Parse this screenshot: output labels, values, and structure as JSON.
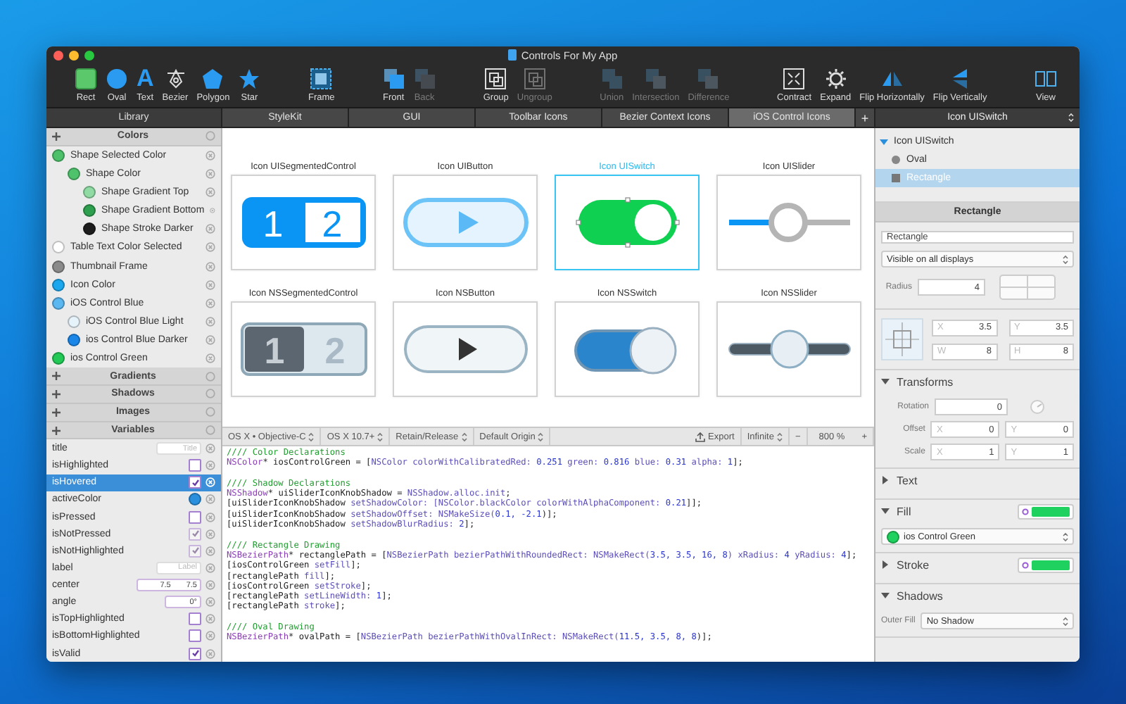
{
  "window": {
    "title": "Controls For My App"
  },
  "toolbar": {
    "groups": [
      [
        {
          "label": "Rect",
          "kind": "rect",
          "disabled": false
        },
        {
          "label": "Oval",
          "kind": "oval",
          "disabled": false
        },
        {
          "label": "Text",
          "kind": "text",
          "glyph": "A",
          "disabled": false
        },
        {
          "label": "Bezier",
          "kind": "bezier",
          "disabled": false
        },
        {
          "label": "Polygon",
          "kind": "polygon",
          "disabled": false
        },
        {
          "label": "Star",
          "kind": "star",
          "disabled": false
        }
      ],
      [
        {
          "label": "Frame",
          "kind": "frame",
          "disabled": false
        }
      ],
      [
        {
          "label": "Front",
          "kind": "front",
          "disabled": false
        },
        {
          "label": "Back",
          "kind": "back",
          "disabled": true
        }
      ],
      [
        {
          "label": "Group",
          "kind": "group",
          "disabled": false
        },
        {
          "label": "Ungroup",
          "kind": "ungroup",
          "disabled": true
        }
      ],
      [
        {
          "label": "Union",
          "kind": "union",
          "disabled": true
        },
        {
          "label": "Intersection",
          "kind": "intersection",
          "disabled": true
        },
        {
          "label": "Difference",
          "kind": "difference",
          "disabled": true
        }
      ],
      [
        {
          "label": "Contract",
          "kind": "contract",
          "disabled": false
        },
        {
          "label": "Expand",
          "kind": "expand",
          "disabled": false
        },
        {
          "label": "Flip Horizontally",
          "kind": "fliph",
          "disabled": false
        },
        {
          "label": "Flip Vertically",
          "kind": "flipv",
          "disabled": false
        }
      ],
      [
        {
          "label": "View",
          "kind": "view",
          "disabled": false
        }
      ]
    ]
  },
  "library": {
    "title": "Library",
    "sections": [
      {
        "title": "Colors",
        "kind": "colors",
        "items": [
          {
            "name": "Shape Selected Color",
            "color": "#4cc16a",
            "children": [
              {
                "name": "Shape Color",
                "color": "#4fc26c",
                "children": [
                  {
                    "name": "Shape Gradient Top",
                    "color": "#8fdba3"
                  },
                  {
                    "name": "Shape Gradient Bottom",
                    "color": "#2e9f4e"
                  },
                  {
                    "name": "Shape Stroke Darker",
                    "color": "#1d1d1d"
                  }
                ]
              }
            ]
          },
          {
            "name": "Table Text Color Selected",
            "color": "#ffffff"
          },
          {
            "name": "Thumbnail Frame",
            "color": "#8a8a8a"
          },
          {
            "name": "Icon Color",
            "color": "#1aa7ee"
          },
          {
            "name": "iOS Control Blue",
            "color": "#5ab7f0",
            "children": [
              {
                "name": "iOS Control Blue Light",
                "color": "#e6f3fb"
              },
              {
                "name": "ios Control Blue Darker",
                "color": "#1a86e8"
              }
            ]
          },
          {
            "name": "ios Control Green",
            "color": "#22c955"
          }
        ]
      },
      {
        "title": "Gradients",
        "kind": "empty"
      },
      {
        "title": "Shadows",
        "kind": "empty"
      },
      {
        "title": "Images",
        "kind": "empty"
      },
      {
        "title": "Variables",
        "kind": "variables",
        "items": [
          {
            "name": "title",
            "kind": "text",
            "placeholder": "Title",
            "selected": false
          },
          {
            "name": "isHighlighted",
            "kind": "bool",
            "checked": false,
            "disabled": false,
            "selected": false
          },
          {
            "name": "isHovered",
            "kind": "bool",
            "checked": true,
            "disabled": false,
            "selected": true
          },
          {
            "name": "activeColor",
            "kind": "color",
            "color": "#2a8fdc",
            "selected": false
          },
          {
            "name": "isPressed",
            "kind": "bool",
            "checked": false,
            "disabled": false,
            "selected": false
          },
          {
            "name": "isNotPressed",
            "kind": "bool",
            "checked": true,
            "disabled": true,
            "selected": false
          },
          {
            "name": "isNotHighlighted",
            "kind": "bool",
            "checked": true,
            "disabled": true,
            "selected": false
          },
          {
            "name": "label",
            "kind": "text",
            "placeholder": "Label",
            "selected": false
          },
          {
            "name": "center",
            "kind": "point",
            "values": [
              "7.5",
              "7.5"
            ],
            "selected": false
          },
          {
            "name": "angle",
            "kind": "angle",
            "value": "0°",
            "selected": false
          },
          {
            "name": "isTopHighlighted",
            "kind": "bool",
            "checked": false,
            "disabled": false,
            "selected": false
          },
          {
            "name": "isBottomHighlighted",
            "kind": "bool",
            "checked": false,
            "disabled": false,
            "selected": false
          },
          {
            "name": "isValid",
            "kind": "bool",
            "checked": true,
            "disabled": false,
            "selected": false
          }
        ]
      }
    ]
  },
  "tabs": [
    {
      "label": "StyleKit",
      "selected": false
    },
    {
      "label": "GUI",
      "selected": false
    },
    {
      "label": "Toolbar Icons",
      "selected": false
    },
    {
      "label": "Bezier Context Icons",
      "selected": false
    },
    {
      "label": "iOS Control Icons",
      "selected": true
    }
  ],
  "add_tab": "+",
  "canvas": {
    "icons": [
      {
        "label": "Icon UISegmentedControl",
        "kind": "segmented-ios",
        "selected": false,
        "texts": [
          "1",
          "2"
        ]
      },
      {
        "label": "Icon UIButton",
        "kind": "button-ios",
        "selected": false
      },
      {
        "label": "Icon UISwitch",
        "kind": "switch-ios",
        "selected": true
      },
      {
        "label": "Icon UISlider",
        "kind": "slider-ios",
        "selected": false
      },
      {
        "label": "Icon NSSegmentedControl",
        "kind": "segmented-mac",
        "selected": false,
        "texts": [
          "1",
          "2"
        ]
      },
      {
        "label": "Icon NSButton",
        "kind": "button-mac",
        "selected": false
      },
      {
        "label": "Icon NSSwitch",
        "kind": "switch-mac",
        "selected": false
      },
      {
        "label": "Icon NSSlider",
        "kind": "slider-mac",
        "selected": false
      }
    ]
  },
  "code": {
    "options": [
      "OS X • Objective-C",
      "OS X 10.7+",
      "Retain/Release",
      "Default Origin"
    ],
    "export": "Export",
    "mode": "Infinite",
    "zoom_out": "−",
    "zoom": "800 %",
    "zoom_in": "+",
    "lines": [
      {
        "parts": [
          {
            "text": "//// Color Declarations",
            "kind": "comment"
          }
        ]
      },
      {
        "parts": [
          {
            "text": "NSColor",
            "kind": "type"
          },
          {
            "text": "* iosControlGreen = [",
            "kind": "plain"
          },
          {
            "text": "NSColor colorWithCalibratedRed: ",
            "kind": "method"
          },
          {
            "text": "0.251",
            "kind": "number"
          },
          {
            "text": " green: ",
            "kind": "method"
          },
          {
            "text": "0.816",
            "kind": "number"
          },
          {
            "text": " blue: ",
            "kind": "method"
          },
          {
            "text": "0.31",
            "kind": "number"
          },
          {
            "text": " alpha: ",
            "kind": "method"
          },
          {
            "text": "1",
            "kind": "number"
          },
          {
            "text": "];",
            "kind": "plain"
          }
        ]
      },
      {
        "block_start": true,
        "parts": [
          {
            "text": "//// Shadow Declarations",
            "kind": "comment"
          }
        ]
      },
      {
        "parts": [
          {
            "text": "NSShadow",
            "kind": "type"
          },
          {
            "text": "* uiSliderIconKnobShadow = ",
            "kind": "plain"
          },
          {
            "text": "NSShadow.alloc.init",
            "kind": "method"
          },
          {
            "text": ";",
            "kind": "plain"
          }
        ]
      },
      {
        "parts": [
          {
            "text": "[uiSliderIconKnobShadow ",
            "kind": "plain"
          },
          {
            "text": "setShadowColor: ",
            "kind": "method"
          },
          {
            "text": "[NSColor.blackColor colorWithAlphaComponent: ",
            "kind": "method"
          },
          {
            "text": "0.21",
            "kind": "number"
          },
          {
            "text": "]];",
            "kind": "plain"
          }
        ]
      },
      {
        "parts": [
          {
            "text": "[uiSliderIconKnobShadow ",
            "kind": "plain"
          },
          {
            "text": "setShadowOffset: NSMakeSize(",
            "kind": "method"
          },
          {
            "text": "0.1, -2.1",
            "kind": "number"
          },
          {
            "text": ")];",
            "kind": "plain"
          }
        ]
      },
      {
        "parts": [
          {
            "text": "[uiSliderIconKnobShadow ",
            "kind": "plain"
          },
          {
            "text": "setShadowBlurRadius: ",
            "kind": "method"
          },
          {
            "text": "2",
            "kind": "number"
          },
          {
            "text": "];",
            "kind": "plain"
          }
        ]
      },
      {
        "block_start": true,
        "parts": [
          {
            "text": "//// Rectangle Drawing",
            "kind": "comment"
          }
        ]
      },
      {
        "parts": [
          {
            "text": "NSBezierPath",
            "kind": "type"
          },
          {
            "text": "* rectanglePath = [",
            "kind": "plain"
          },
          {
            "text": "NSBezierPath bezierPathWithRoundedRect: NSMakeRect(",
            "kind": "method"
          },
          {
            "text": "3.5, 3.5, 16, 8",
            "kind": "number"
          },
          {
            "text": ") xRadius: ",
            "kind": "method"
          },
          {
            "text": "4",
            "kind": "number"
          },
          {
            "text": " yRadius: ",
            "kind": "method"
          },
          {
            "text": "4",
            "kind": "number"
          },
          {
            "text": "];",
            "kind": "plain"
          }
        ]
      },
      {
        "parts": [
          {
            "text": "[iosControlGreen ",
            "kind": "plain"
          },
          {
            "text": "setFill",
            "kind": "method"
          },
          {
            "text": "];",
            "kind": "plain"
          }
        ]
      },
      {
        "parts": [
          {
            "text": "[rectanglePath ",
            "kind": "plain"
          },
          {
            "text": "fill",
            "kind": "method"
          },
          {
            "text": "];",
            "kind": "plain"
          }
        ]
      },
      {
        "parts": [
          {
            "text": "[iosControlGreen ",
            "kind": "plain"
          },
          {
            "text": "setStroke",
            "kind": "method"
          },
          {
            "text": "];",
            "kind": "plain"
          }
        ]
      },
      {
        "parts": [
          {
            "text": "[rectanglePath ",
            "kind": "plain"
          },
          {
            "text": "setLineWidth: ",
            "kind": "method"
          },
          {
            "text": "1",
            "kind": "number"
          },
          {
            "text": "];",
            "kind": "plain"
          }
        ]
      },
      {
        "parts": [
          {
            "text": "[rectanglePath ",
            "kind": "plain"
          },
          {
            "text": "stroke",
            "kind": "method"
          },
          {
            "text": "];",
            "kind": "plain"
          }
        ]
      },
      {
        "block_start": true,
        "parts": [
          {
            "text": "//// Oval Drawing",
            "kind": "comment"
          }
        ]
      },
      {
        "parts": [
          {
            "text": "NSBezierPath",
            "kind": "type"
          },
          {
            "text": "* ovalPath = [",
            "kind": "plain"
          },
          {
            "text": "NSBezierPath bezierPathWithOvalInRect: NSMakeRect(",
            "kind": "method"
          },
          {
            "text": "11.5, 3.5, 8, 8",
            "kind": "number"
          },
          {
            "text": ")];",
            "kind": "plain"
          }
        ]
      }
    ]
  },
  "inspector": {
    "title": "Icon UISwitch",
    "tree": [
      {
        "label": "Icon UISwitch",
        "kind": "group",
        "expanded": true,
        "selected": false,
        "children": [
          {
            "label": "Oval",
            "kind": "oval",
            "selected": false
          },
          {
            "label": "Rectangle",
            "kind": "rect",
            "selected": true
          }
        ]
      }
    ],
    "shape": {
      "title": "Rectangle",
      "name": "Rectangle",
      "visibility": "Visible on all displays",
      "radius_label": "Radius",
      "radius": "4",
      "position": [
        {
          "label": "X",
          "value": "3.5"
        },
        {
          "label": "Y",
          "value": "3.5"
        },
        {
          "label": "W",
          "value": "8"
        },
        {
          "label": "H",
          "value": "8"
        }
      ]
    },
    "sections": [
      {
        "title": "Transforms",
        "kind": "transforms",
        "expanded": true,
        "rows": [
          {
            "label": "Rotation",
            "fields": [
              {
                "value": "0"
              }
            ]
          },
          {
            "label": "Offset",
            "fields": [
              {
                "prefix": "X",
                "value": "0"
              },
              {
                "prefix": "Y",
                "value": "0"
              }
            ]
          },
          {
            "label": "Scale",
            "fields": [
              {
                "prefix": "X",
                "value": "1"
              },
              {
                "prefix": "Y",
                "value": "1"
              }
            ]
          }
        ]
      },
      {
        "title": "Text",
        "expanded": false
      },
      {
        "title": "Fill",
        "kind": "fill",
        "expanded": true,
        "color": "#1fd15e",
        "value": "ios Control Green"
      },
      {
        "title": "Stroke",
        "expanded": false,
        "color": "#1fd15e"
      },
      {
        "title": "Shadows",
        "kind": "shadow",
        "expanded": true,
        "label": "Outer Fill",
        "value": "No Shadow"
      }
    ]
  }
}
